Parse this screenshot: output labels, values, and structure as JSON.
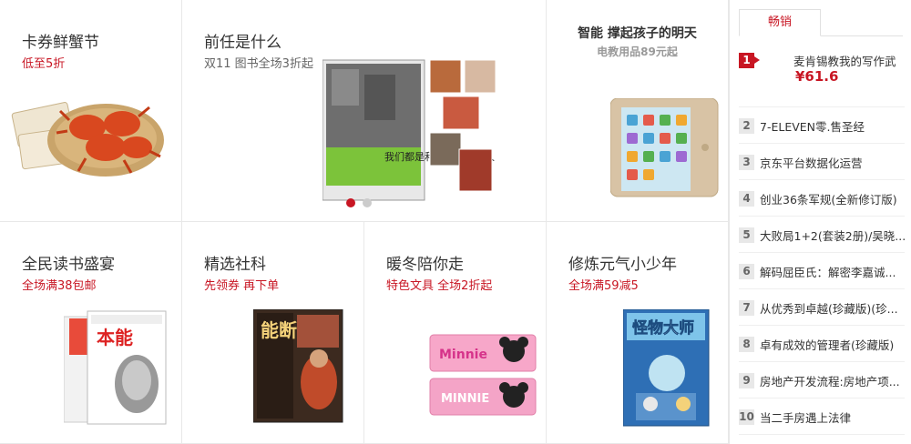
{
  "cells": {
    "crab": {
      "title": "卡券鲜蟹节",
      "subtitle": "低至5折"
    },
    "book": {
      "title": "前任是什么",
      "subtitle": "双11 图书全场3折起",
      "book_cover_text": "我们都是和自己赛跑的人"
    },
    "tablet": {
      "title": "智能 撑起孩子的明天",
      "subtitle": "电教用品89元起"
    },
    "reading": {
      "title": "全民读书盛宴",
      "subtitle": "全场满38包邮",
      "book_cover_text": "本能"
    },
    "social": {
      "title": "精选社科",
      "subtitle": "先领券 再下单",
      "book_cover_text": "能断"
    },
    "winter": {
      "title": "暖冬陪你走",
      "subtitle": "特色文具 全场2折起",
      "box_text_1": "Minnie",
      "box_text_2": "MINNIE"
    },
    "youth": {
      "title": "修炼元气小少年",
      "subtitle": "全场满59减5",
      "book_cover_text": "怪物大师"
    }
  },
  "ranking": {
    "tab_label": "畅销",
    "first": {
      "rank": "1",
      "title": "麦肯锡教我的写作武",
      "price": "¥61.6"
    },
    "items": [
      {
        "rank": "2",
        "title": "7-ELEVEN零.售圣经"
      },
      {
        "rank": "3",
        "title": "京东平台数据化运营"
      },
      {
        "rank": "4",
        "title": "创业36条军规(全新修订版)"
      },
      {
        "rank": "5",
        "title": "大败局1+2(套装2册)/吴晓..."
      },
      {
        "rank": "6",
        "title": "解码屈臣氏：解密李嘉诚..."
      },
      {
        "rank": "7",
        "title": "从优秀到卓越(珍藏版)(珍..."
      },
      {
        "rank": "8",
        "title": "卓有成效的管理者(珍藏版)"
      },
      {
        "rank": "9",
        "title": "房地产开发流程:房地产项..."
      },
      {
        "rank": "10",
        "title": "当二手房遇上法律"
      }
    ]
  },
  "colors": {
    "accent": "#c81623",
    "border": "#e8e8e8"
  },
  "carousel": {
    "count": 2,
    "active": 1
  }
}
